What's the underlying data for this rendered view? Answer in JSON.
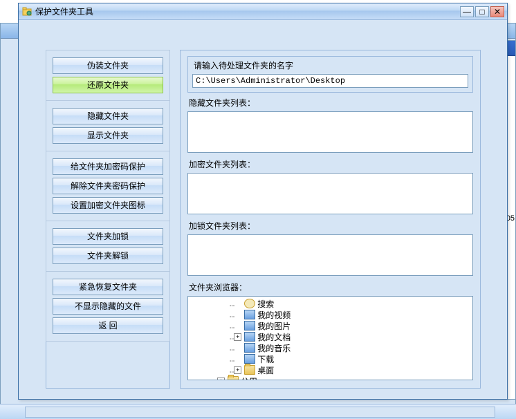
{
  "window": {
    "title": "保护文件夹工具",
    "min": "—",
    "max": "□",
    "close": "✕"
  },
  "sidebar": {
    "btn_disguise": "伪装文件夹",
    "btn_restore": "还原文件夹",
    "btn_hide": "隐藏文件夹",
    "btn_show": "显示文件夹",
    "btn_encrypt": "给文件夹加密码保护",
    "btn_decrypt": "解除文件夹密码保护",
    "btn_seticon": "设置加密文件夹图标",
    "btn_lock": "文件夹加锁",
    "btn_unlock": "文件夹解锁",
    "btn_emergency": "紧急恢复文件夹",
    "btn_noshow": "不显示隐藏的文件",
    "btn_back": "返    回"
  },
  "main": {
    "path_label": "请输入待处理文件夹的名字",
    "path_value": "C:\\Users\\Administrator\\Desktop",
    "hidden_label": "隐藏文件夹列表：",
    "encrypted_label": "加密文件夹列表：",
    "locked_label": "加锁文件夹列表：",
    "browser_label": "文件夹浏览器："
  },
  "tree": {
    "items": [
      {
        "icon": "search",
        "label": "搜索",
        "expandable": false
      },
      {
        "icon": "blue",
        "label": "我的视频",
        "expandable": false
      },
      {
        "icon": "blue",
        "label": "我的图片",
        "expandable": false
      },
      {
        "icon": "blue",
        "label": "我的文档",
        "expandable": true
      },
      {
        "icon": "blue",
        "label": "我的音乐",
        "expandable": false
      },
      {
        "icon": "blue",
        "label": "下载",
        "expandable": false
      },
      {
        "icon": "folder",
        "label": "桌面",
        "expandable": true
      },
      {
        "icon": "folder",
        "label": "公用",
        "expandable": true,
        "outdent": true
      }
    ]
  },
  "right_edge": "05"
}
